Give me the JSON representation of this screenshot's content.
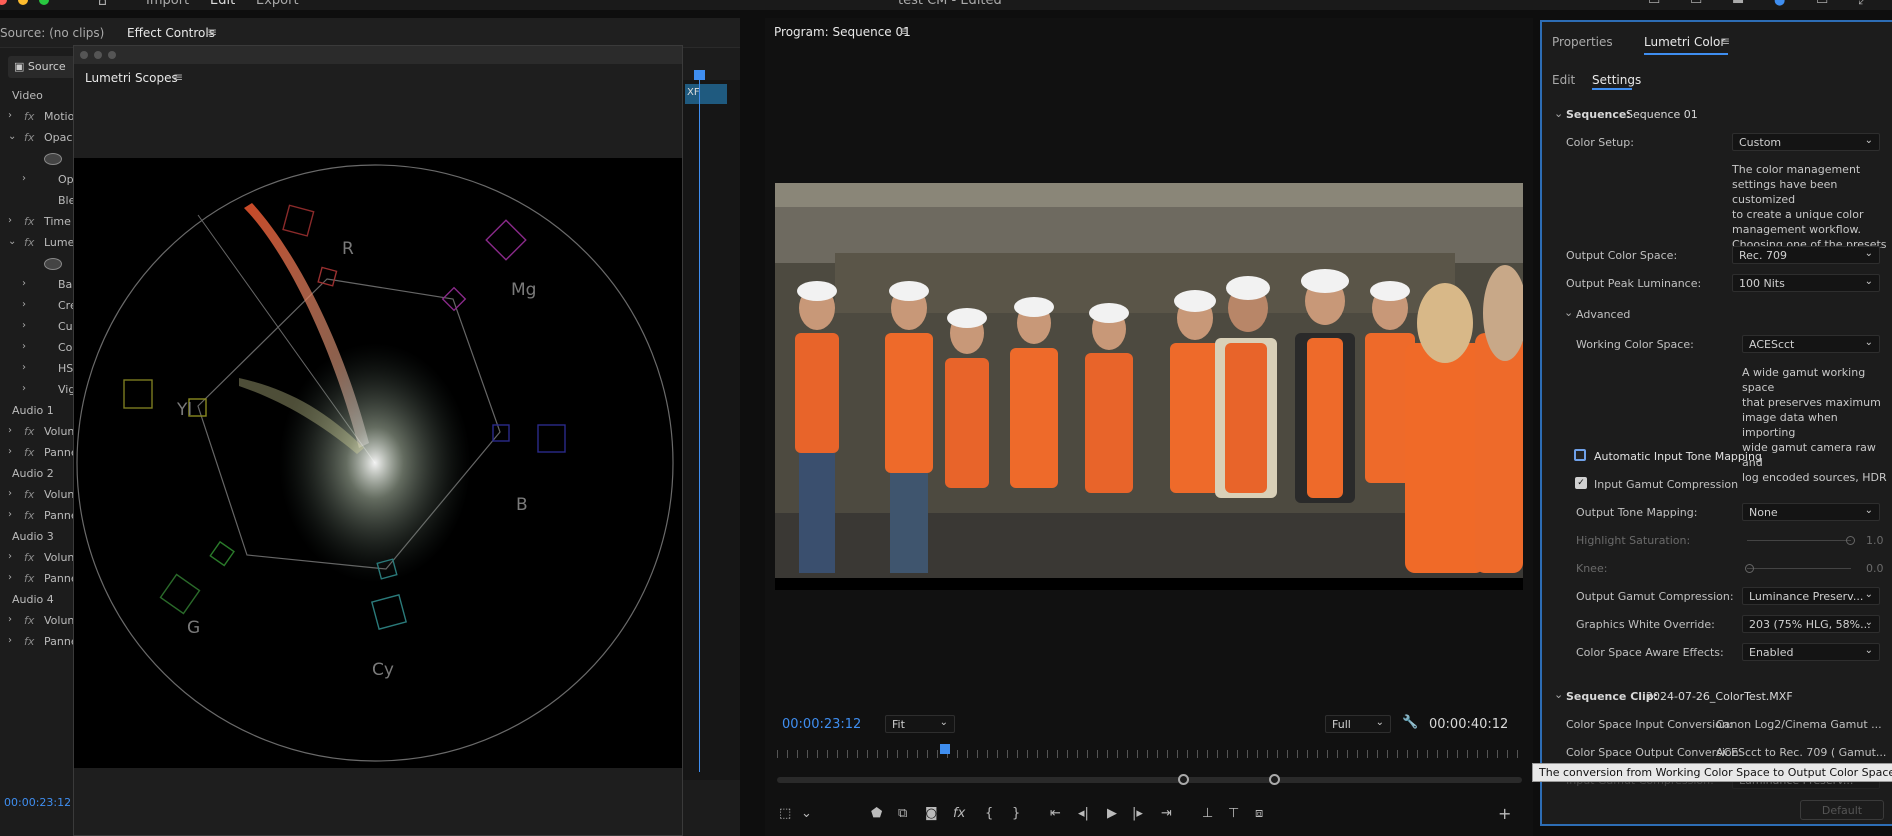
{
  "app": {
    "title": "test CM - Edited",
    "nav": [
      "Import",
      "Edit",
      "Export"
    ]
  },
  "source_panel": {
    "tabs": [
      "Source: (no clips)",
      "Effect Controls"
    ],
    "source_btn": "Source",
    "timecode": "00:00:23:12",
    "rows": [
      {
        "label": "Video",
        "type": "section"
      },
      {
        "label": "Motio",
        "type": "fx"
      },
      {
        "label": "Opaci",
        "type": "fx-open"
      },
      {
        "label": "Op",
        "type": "sub"
      },
      {
        "label": "Ble",
        "type": "plain"
      },
      {
        "label": "Time",
        "type": "fx"
      },
      {
        "label": "Lume",
        "type": "fx-open"
      },
      {
        "label": "Ba",
        "type": "sub"
      },
      {
        "label": "Cre",
        "type": "sub"
      },
      {
        "label": "Cu",
        "type": "sub"
      },
      {
        "label": "Co",
        "type": "sub"
      },
      {
        "label": "HS",
        "type": "sub"
      },
      {
        "label": "Vig",
        "type": "sub"
      },
      {
        "label": "Audio 1",
        "type": "section"
      },
      {
        "label": "Volun",
        "type": "fx"
      },
      {
        "label": "Panne",
        "type": "fx"
      },
      {
        "label": "Audio 2",
        "type": "section"
      },
      {
        "label": "Volun",
        "type": "fx"
      },
      {
        "label": "Panne",
        "type": "fx"
      },
      {
        "label": "Audio 3",
        "type": "section"
      },
      {
        "label": "Volun",
        "type": "fx"
      },
      {
        "label": "Panne",
        "type": "fx"
      },
      {
        "label": "Audio 4",
        "type": "section"
      },
      {
        "label": "Volun",
        "type": "fx"
      },
      {
        "label": "Panne",
        "type": "fx"
      }
    ]
  },
  "scopes": {
    "title": "Lumetri Scopes",
    "labels": {
      "r": "R",
      "mg": "Mg",
      "yl": "Yl",
      "b": "B",
      "g": "G",
      "cy": "Cy"
    }
  },
  "timeline": {
    "clip_label": "XF"
  },
  "program": {
    "title": "Program: Sequence 01",
    "timecode_current": "00:00:23:12",
    "timecode_duration": "00:00:40:12",
    "zoom": "Fit",
    "resolution": "Full"
  },
  "lumetri": {
    "tabs": [
      "Properties",
      "Lumetri Color"
    ],
    "subtabs": [
      "Edit",
      "Settings"
    ],
    "sequence_header": "Sequence:",
    "sequence_name": "Sequence 01",
    "color_setup_label": "Color Setup:",
    "color_setup_value": "Custom",
    "color_setup_desc": [
      "The color management",
      "settings have been customized",
      "to create a unique color",
      "management workflow.",
      "Choosing one of the presets in"
    ],
    "output_color_space_label": "Output Color Space:",
    "output_color_space_value": "Rec. 709",
    "output_peak_label": "Output Peak Luminance:",
    "output_peak_value": "100 Nits",
    "advanced_label": "Advanced",
    "working_cs_label": "Working Color Space:",
    "working_cs_value": "ACEScct",
    "working_cs_desc": [
      "A wide gamut working space",
      "that preserves maximum",
      "image data when importing",
      "wide gamut camera raw and",
      "log encoded sources, HDR"
    ],
    "auto_tone_label": "Automatic Input Tone Mapping",
    "gamut_comp_label": "Input Gamut Compression",
    "output_tone_label": "Output Tone Mapping:",
    "output_tone_value": "None",
    "highlight_sat_label": "Highlight Saturation:",
    "highlight_sat_value": "1.0",
    "knee_label": "Knee:",
    "knee_value": "0.0",
    "output_gamut_label": "Output Gamut Compression:",
    "output_gamut_value": "Luminance Preserv...",
    "graphics_white_label": "Graphics White Override:",
    "graphics_white_value": "203 (75% HLG, 58%...",
    "cs_aware_label": "Color Space Aware Effects:",
    "cs_aware_value": "Enabled",
    "clip_header": "Sequence Clip:",
    "clip_name": "2024-07-26_ColorTest.MXF",
    "cs_input_label": "Color Space Input Conversion:",
    "cs_input_value": "Canon Log2/Cinema Gamut ...",
    "cs_output_label": "Color Space Output Conversion:",
    "cs_output_value": "ACEScct to Rec. 709 ( Gamut...",
    "tooltip": "The conversion from Working Color Space to Output Color Space.",
    "partial_row": "Input Gamut Compression:",
    "partial_value": "Luminance Preserv...",
    "default_btn": "Default"
  }
}
